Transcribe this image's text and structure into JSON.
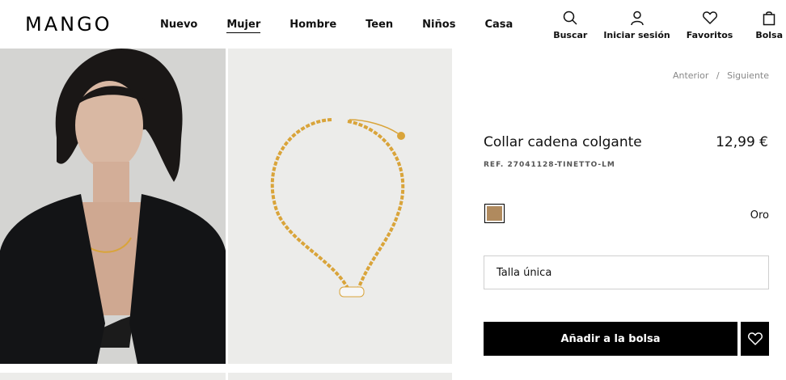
{
  "brand": {
    "logo": "MANGO"
  },
  "nav": {
    "items": [
      {
        "label": "Nuevo",
        "active": false
      },
      {
        "label": "Mujer",
        "active": true
      },
      {
        "label": "Hombre",
        "active": false
      },
      {
        "label": "Teen",
        "active": false
      },
      {
        "label": "Niños",
        "active": false
      },
      {
        "label": "Casa",
        "active": false
      }
    ]
  },
  "tools": {
    "search": {
      "label": "Buscar",
      "icon": "search-icon"
    },
    "login": {
      "label": "Iniciar sesión",
      "icon": "user-icon"
    },
    "favorites": {
      "label": "Favoritos",
      "icon": "heart-icon"
    },
    "bag": {
      "label": "Bolsa",
      "icon": "bag-icon"
    }
  },
  "pager": {
    "prev": "Anterior",
    "separator": "/",
    "next": "Siguiente"
  },
  "product": {
    "name": "Collar cadena colgante",
    "price": "12,99 €",
    "ref": "REF. 27041128-TINETTO-LM",
    "color": {
      "name": "Oro",
      "swatch": "#b08a5e"
    },
    "size": "Talla única",
    "add_to_bag": "Añadir a la bolsa"
  },
  "colors": {
    "accent": "#000000",
    "gold": "#d9a43a"
  }
}
